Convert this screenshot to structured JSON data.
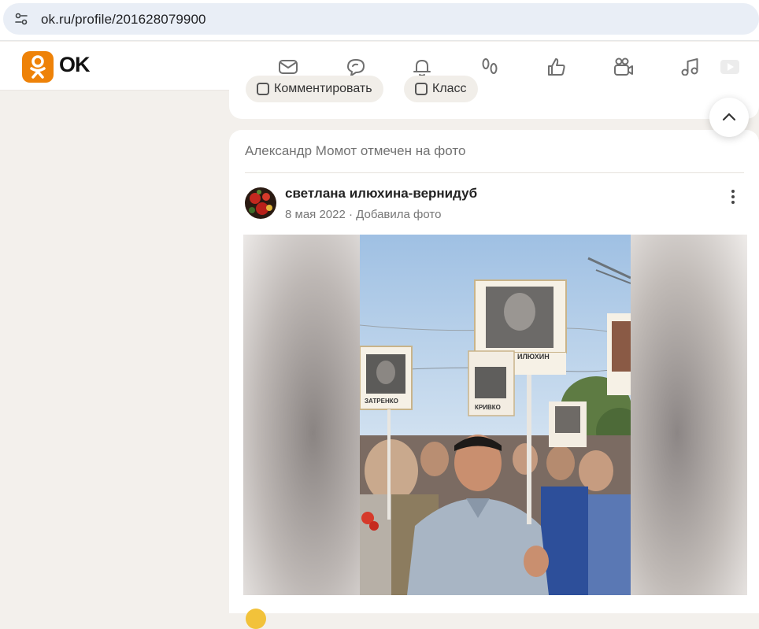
{
  "browser": {
    "url": "ok.ru/profile/201628079900",
    "site_info_icon": "tune-icon"
  },
  "header": {
    "logo_text": "OK",
    "brand_color": "#ee8208",
    "nav_icons": [
      "mail-icon",
      "chat-icon",
      "bell-icon",
      "footprints-icon",
      "thumbs-up-icon",
      "video-camera-icon",
      "music-icon",
      "play-icon"
    ]
  },
  "prev_post": {
    "comment_label": "Комментировать",
    "like_label": "Класс"
  },
  "post": {
    "tagged_text": "Александр Момот отмечен на фото",
    "author_name": "светлана илюхина-вернидуб",
    "meta_text": "8 мая 2022 · Добавила фото",
    "photo_placard_names": [
      "ИЛЮХИН",
      "КРИВКО",
      "ЗАТРЕНКО"
    ]
  },
  "colors": {
    "page_bg": "#f3f0ec",
    "card_bg": "#ffffff",
    "accent": "#ee8208"
  }
}
